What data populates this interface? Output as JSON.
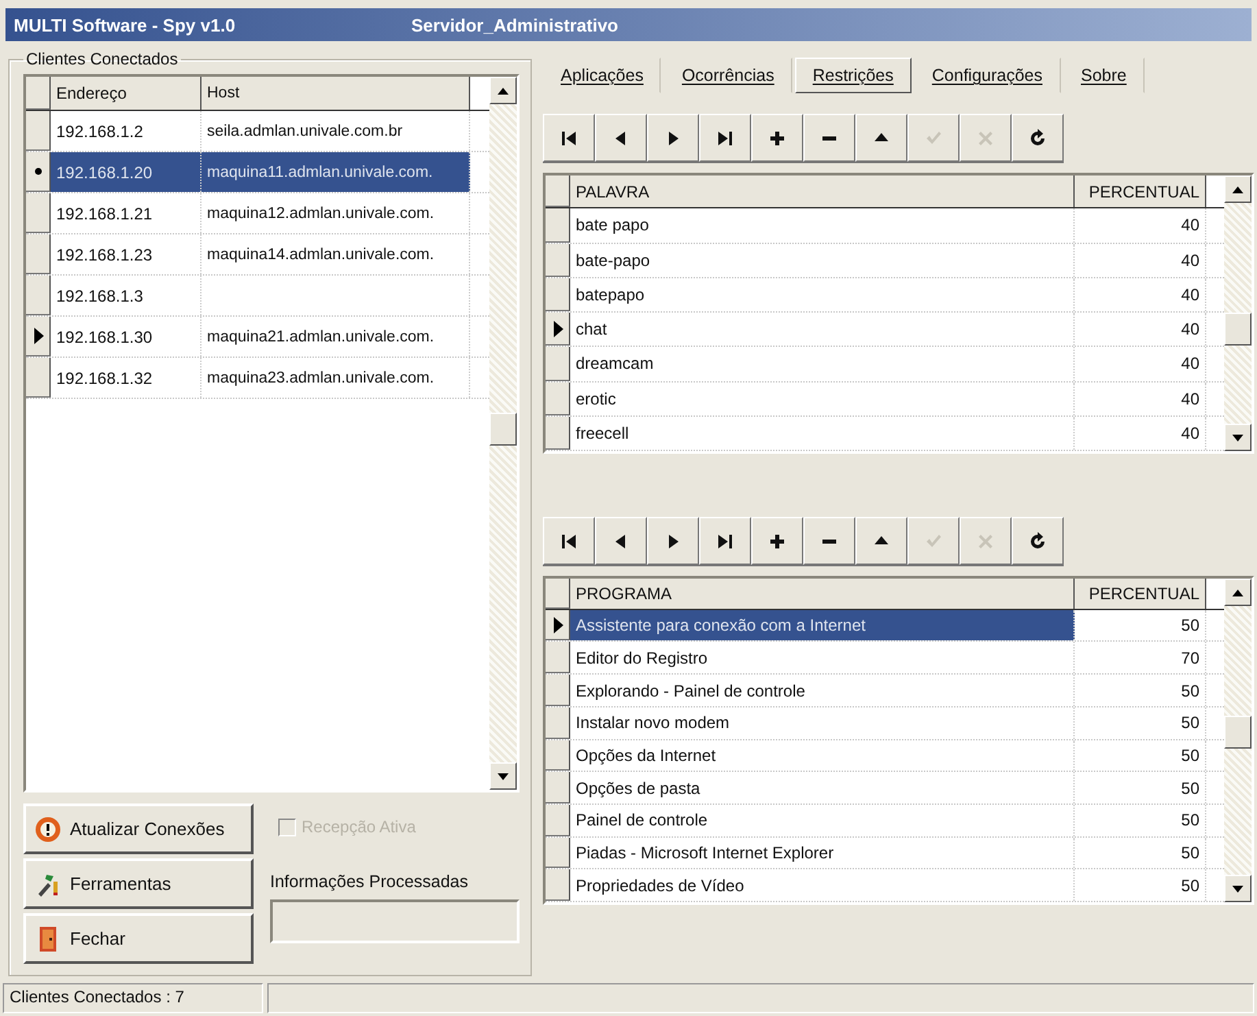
{
  "window": {
    "title": "MULTI Software - Spy v1.0",
    "subtitle": "Servidor_Administrativo"
  },
  "clients": {
    "label": "Clientes Conectados",
    "grid": {
      "row_select": true,
      "columns": [
        "Endereço",
        "Host"
      ],
      "rows": [
        {
          "cells": [
            "192.168.1.2",
            "seila.admlan.univale.com.br"
          ],
          "current": false,
          "selected": false
        },
        {
          "cells": [
            "192.168.1.20",
            "maquina11.admlan.univale.com."
          ],
          "current": false,
          "selected": true
        },
        {
          "cells": [
            "192.168.1.21",
            "maquina12.admlan.univale.com."
          ],
          "current": false,
          "selected": false
        },
        {
          "cells": [
            "192.168.1.23",
            "maquina14.admlan.univale.com."
          ],
          "current": false,
          "selected": false
        },
        {
          "cells": [
            "192.168.1.3",
            ""
          ],
          "current": false,
          "selected": false
        },
        {
          "cells": [
            "192.168.1.30",
            "maquina21.admlan.univale.com."
          ],
          "current": true,
          "selected": false
        },
        {
          "cells": [
            "192.168.1.32",
            "maquina23.admlan.univale.com."
          ],
          "current": false,
          "selected": false
        }
      ]
    },
    "buttons": [
      {
        "kind": "refresh",
        "label": "Atualizar Conexões"
      },
      {
        "kind": "tools",
        "label": "Ferramentas"
      },
      {
        "kind": "exit",
        "label": "Fechar"
      }
    ],
    "reception": {
      "label": "Recepção Ativa",
      "checked": false,
      "disabled": true
    },
    "processed": {
      "label": "Informações Processadas"
    }
  },
  "tabs": [
    {
      "label": "Aplicações",
      "selected": false
    },
    {
      "label": "Ocorrências",
      "selected": false
    },
    {
      "label": "Restrições",
      "selected": true
    },
    {
      "label": "Configurações",
      "selected": false
    },
    {
      "label": "Sobre",
      "selected": false
    }
  ],
  "navigators": [
    [
      {
        "kind": "first",
        "disabled": false
      },
      {
        "kind": "prior",
        "disabled": false
      },
      {
        "kind": "next",
        "disabled": false
      },
      {
        "kind": "last",
        "disabled": false
      },
      {
        "kind": "insert",
        "disabled": false
      },
      {
        "kind": "delete",
        "disabled": false
      },
      {
        "kind": "edit",
        "disabled": false
      },
      {
        "kind": "post",
        "disabled": true
      },
      {
        "kind": "cancel",
        "disabled": true
      },
      {
        "kind": "refresh",
        "disabled": false
      }
    ],
    [
      {
        "kind": "first",
        "disabled": false
      },
      {
        "kind": "prior",
        "disabled": false
      },
      {
        "kind": "next",
        "disabled": false
      },
      {
        "kind": "last",
        "disabled": false
      },
      {
        "kind": "insert",
        "disabled": false
      },
      {
        "kind": "delete",
        "disabled": false
      },
      {
        "kind": "edit",
        "disabled": false
      },
      {
        "kind": "post",
        "disabled": true
      },
      {
        "kind": "cancel",
        "disabled": true
      },
      {
        "kind": "refresh",
        "disabled": false
      }
    ]
  ],
  "words": {
    "columns": [
      "PALAVRA",
      "PERCENTUAL"
    ],
    "rows": [
      {
        "cells": [
          "bate papo",
          "40"
        ],
        "current": false,
        "selected": false
      },
      {
        "cells": [
          "bate-papo",
          "40"
        ],
        "current": false,
        "selected": false
      },
      {
        "cells": [
          "batepapo",
          "40"
        ],
        "current": false,
        "selected": false
      },
      {
        "cells": [
          "chat",
          "40"
        ],
        "current": true,
        "selected": false
      },
      {
        "cells": [
          "dreamcam",
          "40"
        ],
        "current": false,
        "selected": false
      },
      {
        "cells": [
          "erotic",
          "40"
        ],
        "current": false,
        "selected": false
      },
      {
        "cells": [
          "freecell",
          "40"
        ],
        "current": false,
        "selected": false
      }
    ]
  },
  "programs": {
    "row_select": false,
    "columns": [
      "PROGRAMA",
      "PERCENTUAL"
    ],
    "rows": [
      {
        "cells": [
          "Assistente para conexão com a Internet",
          "50"
        ],
        "current": true,
        "selected": true
      },
      {
        "cells": [
          "Editor do Registro",
          "70"
        ],
        "current": false,
        "selected": false
      },
      {
        "cells": [
          "Explorando - Painel de controle",
          "50"
        ],
        "current": false,
        "selected": false
      },
      {
        "cells": [
          "Instalar novo modem",
          "50"
        ],
        "current": false,
        "selected": false
      },
      {
        "cells": [
          "Opções da Internet",
          "50"
        ],
        "current": false,
        "selected": false
      },
      {
        "cells": [
          "Opções de pasta",
          "50"
        ],
        "current": false,
        "selected": false
      },
      {
        "cells": [
          "Painel de controle",
          "50"
        ],
        "current": false,
        "selected": false
      },
      {
        "cells": [
          "Piadas - Microsoft Internet Explorer",
          "50"
        ],
        "current": false,
        "selected": false
      },
      {
        "cells": [
          "Propriedades de Vídeo",
          "50"
        ],
        "current": false,
        "selected": false
      }
    ]
  },
  "status_bar": [
    "Clientes Conectados : 7"
  ]
}
